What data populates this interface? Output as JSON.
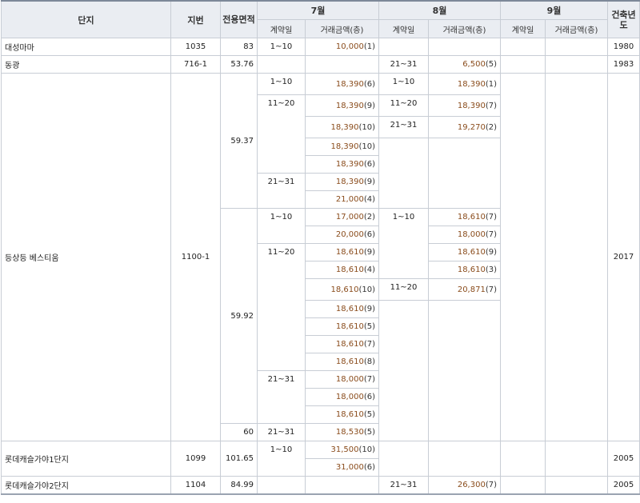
{
  "headers": {
    "complex": "단지",
    "lot": "지번",
    "area": "전용면적",
    "jul": "7월",
    "aug": "8월",
    "sep": "9월",
    "built": "건축년도",
    "contract_day": "계약일",
    "amount": "거래금액(층)"
  },
  "rows": {
    "daeseong": {
      "name": "대성마마",
      "lot": "1035",
      "area": "83",
      "built": "1980",
      "jul": [
        {
          "day": "1~10",
          "amount": "10,000",
          "floor": "(1)"
        }
      ]
    },
    "donggwang": {
      "name": "동광",
      "lot": "716-1",
      "area": "53.76",
      "built": "1983",
      "aug": [
        {
          "day": "21~31",
          "amount": "6,500",
          "floor": "(5)"
        }
      ]
    },
    "vestium": {
      "name": "등상등 베스티움",
      "lot": "1100-1",
      "built": "2017",
      "area_a": "59.37",
      "area_b": "59.92",
      "area_c": "60",
      "a_jul": [
        {
          "day": "1~10",
          "amount": "18,390",
          "floor": "(6)"
        },
        {
          "day": "11~20",
          "amount": "18,390",
          "floor": "(9)"
        },
        {
          "amount": "18,390",
          "floor": "(10)"
        },
        {
          "amount": "18,390",
          "floor": "(10)"
        },
        {
          "amount": "18,390",
          "floor": "(6)"
        },
        {
          "day": "21~31",
          "amount": "18,390",
          "floor": "(9)"
        },
        {
          "amount": "21,000",
          "floor": "(4)"
        }
      ],
      "a_aug": [
        {
          "day": "1~10",
          "amount": "18,390",
          "floor": "(1)"
        },
        {
          "day": "11~20",
          "amount": "18,390",
          "floor": "(7)"
        },
        {
          "day": "21~31",
          "amount": "19,270",
          "floor": "(2)"
        }
      ],
      "b_jul": [
        {
          "day": "1~10",
          "amount": "17,000",
          "floor": "(2)"
        },
        {
          "amount": "20,000",
          "floor": "(6)"
        },
        {
          "day": "11~20",
          "amount": "18,610",
          "floor": "(9)"
        },
        {
          "amount": "18,610",
          "floor": "(4)"
        },
        {
          "amount": "18,610",
          "floor": "(10)"
        },
        {
          "amount": "18,610",
          "floor": "(9)"
        },
        {
          "amount": "18,610",
          "floor": "(5)"
        },
        {
          "amount": "18,610",
          "floor": "(7)"
        },
        {
          "amount": "18,610",
          "floor": "(8)"
        },
        {
          "day": "21~31",
          "amount": "18,000",
          "floor": "(7)"
        },
        {
          "amount": "18,000",
          "floor": "(6)"
        },
        {
          "amount": "18,610",
          "floor": "(5)"
        }
      ],
      "b_aug": [
        {
          "day": "1~10",
          "amount": "18,610",
          "floor": "(7)"
        },
        {
          "amount": "18,000",
          "floor": "(7)"
        },
        {
          "amount": "18,610",
          "floor": "(9)"
        },
        {
          "amount": "18,610",
          "floor": "(3)"
        },
        {
          "day": "11~20",
          "amount": "20,871",
          "floor": "(7)"
        }
      ],
      "c_jul": [
        {
          "day": "21~31",
          "amount": "18,530",
          "floor": "(5)"
        }
      ]
    },
    "lotte1": {
      "name": "롯데캐슬가야1단지",
      "lot": "1099",
      "area": "101.65",
      "built": "2005",
      "jul": [
        {
          "day": "1~10",
          "amount": "31,500",
          "floor": "(10)"
        },
        {
          "amount": "31,000",
          "floor": "(6)"
        }
      ]
    },
    "lotte2": {
      "name": "롯데캐슬가야2단지",
      "lot": "1104",
      "area": "84.99",
      "built": "2005",
      "aug": [
        {
          "day": "21~31",
          "amount": "26,300",
          "floor": "(7)"
        }
      ]
    }
  }
}
